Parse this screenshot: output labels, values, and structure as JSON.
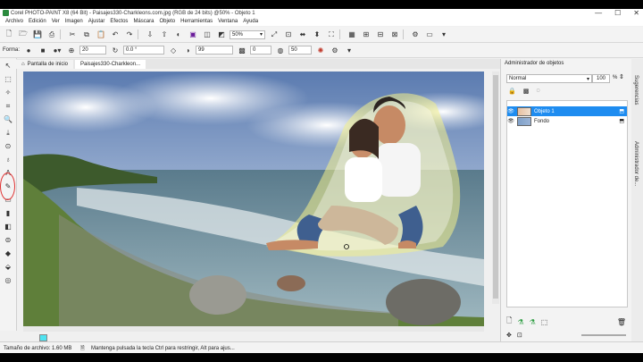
{
  "window": {
    "title": "Corel PHOTO-PAINT X8 (64 Bit) - Paisajes330-Charkleons.com.jpg (RGB de 24 bits) @50% - Objeto 1",
    "minimize_glyph": "—",
    "maximize_glyph": "☐",
    "close_glyph": "✕"
  },
  "menu": [
    "Archivo",
    "Edición",
    "Ver",
    "Imagen",
    "Ajustar",
    "Efectos",
    "Máscara",
    "Objeto",
    "Herramientas",
    "Ventana",
    "Ayuda"
  ],
  "toolbar": {
    "zoom_value": "50%"
  },
  "property_bar": {
    "label": "Forma:",
    "size_value": "20",
    "rotation_value": "0.0 °",
    "opacity_value": "99",
    "field_a": "0",
    "field_b": "50"
  },
  "document_tabs": [
    "Pantalla de inicio",
    "Paisajes330-Charkleon..."
  ],
  "status": {
    "file_size": "Tamaño de archivo: 1.60 MB",
    "hint": "Mantenga pulsada la tecla Ctrl para restringir, Alt para ajus..."
  },
  "panel": {
    "title": "Administrador de objetos",
    "blend_mode": "Normal",
    "opacity": "100",
    "percent": "%",
    "layers": [
      {
        "name": "Objeto 1",
        "selected": true
      },
      {
        "name": "Fondo",
        "selected": false
      }
    ]
  },
  "side_tabs": [
    "Sugerencias",
    "Administrador de..."
  ],
  "colors": {
    "accent": "#1e8cf0",
    "highlight_circle": "#e03131",
    "swatch": "#4fe3f0"
  }
}
